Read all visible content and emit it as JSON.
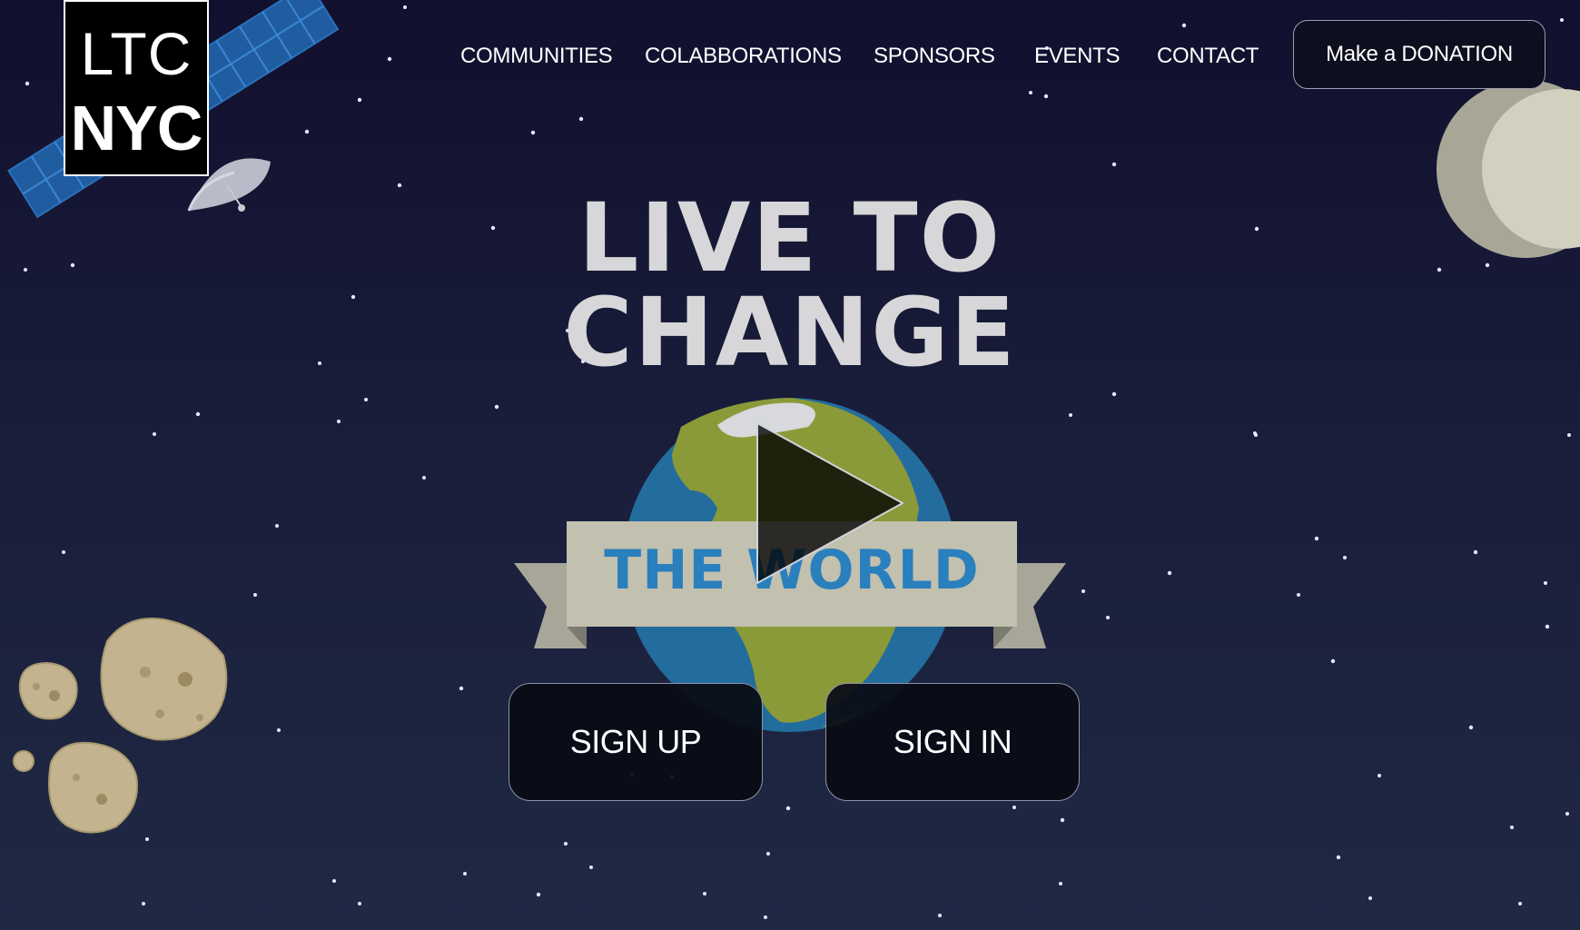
{
  "logo": {
    "line1": "LTC",
    "line2": "NYC"
  },
  "nav": {
    "items": [
      {
        "label": "COMMUNITIES"
      },
      {
        "label": "COLABBORATIONS"
      },
      {
        "label": "SPONSORS"
      },
      {
        "label": "EVENTS"
      },
      {
        "label": "CONTACT"
      }
    ],
    "donate_label": "Make a DONATION"
  },
  "hero": {
    "headline_line1": "LIVE TO",
    "headline_line2": "CHANGE",
    "banner_text": "THE WORLD"
  },
  "actions": {
    "signup_label": "SIGN UP",
    "signin_label": "SIGN IN"
  },
  "icons": [
    "satellite-icon",
    "moon-icon",
    "asteroid-icon",
    "earth-icon",
    "play-icon"
  ],
  "colors": {
    "background_top": "#11102e",
    "background_bottom": "#1f2944",
    "headline": "#d7d7d9",
    "banner_text": "#2a7fbd",
    "ribbon": "#c2c0ae"
  }
}
